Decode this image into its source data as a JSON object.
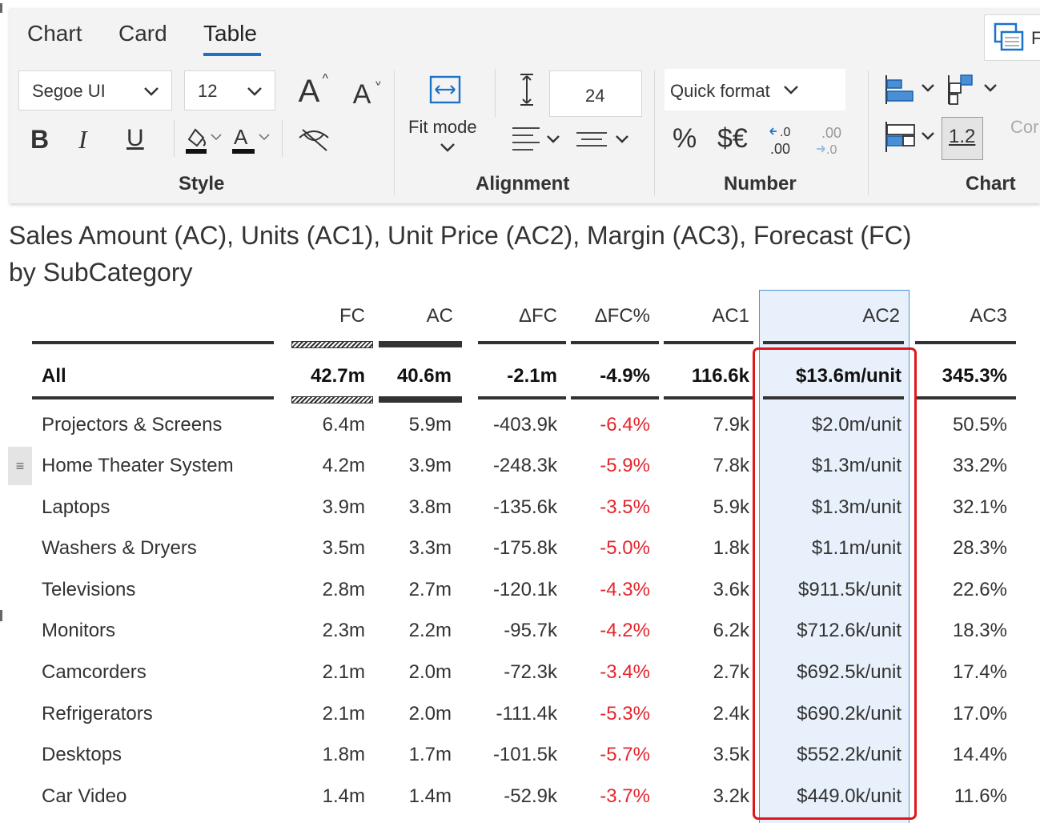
{
  "ribbon": {
    "tabs": [
      {
        "label": "Chart"
      },
      {
        "label": "Card"
      },
      {
        "label": "Table"
      }
    ],
    "active_tab": "Table",
    "style": {
      "font_family": "Segoe UI",
      "font_size": "12",
      "bold": "B",
      "italic": "I",
      "underline": "U",
      "group_label": "Style"
    },
    "alignment": {
      "fit_mode_label": "Fit mode",
      "row_height": "24",
      "group_label": "Alignment"
    },
    "number": {
      "quick_format_label": "Quick format",
      "percent_label": "%",
      "currency_label": "$€",
      "group_label": "Number"
    },
    "chart": {
      "decimal_label": "1.2",
      "partial_label": "Cor",
      "group_label": "Chart"
    },
    "panel_partial_label": "F"
  },
  "visual": {
    "title_line1": "Sales Amount (AC), Units (AC1), Unit Price (AC2), Margin (AC3), Forecast (FC)",
    "title_line2": "by SubCategory"
  },
  "table": {
    "columns": [
      "FC",
      "AC",
      "ΔFC",
      "ΔFC%",
      "AC1",
      "AC2",
      "AC3"
    ],
    "selected_column": "AC2",
    "total": {
      "name": "All",
      "values": [
        "42.7m",
        "40.6m",
        "-2.1m",
        "-4.9%",
        "116.6k",
        "$13.6m/unit",
        "345.3%"
      ]
    },
    "rows": [
      {
        "name": "Projectors & Screens",
        "values": [
          "6.4m",
          "5.9m",
          "-403.9k",
          "-6.4%",
          "7.9k",
          "$2.0m/unit",
          "50.5%"
        ]
      },
      {
        "name": "Home Theater System",
        "values": [
          "4.2m",
          "3.9m",
          "-248.3k",
          "-5.9%",
          "7.8k",
          "$1.3m/unit",
          "33.2%"
        ]
      },
      {
        "name": "Laptops",
        "values": [
          "3.9m",
          "3.8m",
          "-135.6k",
          "-3.5%",
          "5.9k",
          "$1.3m/unit",
          "32.1%"
        ]
      },
      {
        "name": "Washers & Dryers",
        "values": [
          "3.5m",
          "3.3m",
          "-175.8k",
          "-5.0%",
          "1.8k",
          "$1.1m/unit",
          "28.3%"
        ]
      },
      {
        "name": "Televisions",
        "values": [
          "2.8m",
          "2.7m",
          "-120.1k",
          "-4.3%",
          "3.6k",
          "$911.5k/unit",
          "22.6%"
        ]
      },
      {
        "name": "Monitors",
        "values": [
          "2.3m",
          "2.2m",
          "-95.7k",
          "-4.2%",
          "6.2k",
          "$712.6k/unit",
          "18.3%"
        ]
      },
      {
        "name": "Camcorders",
        "values": [
          "2.1m",
          "2.0m",
          "-72.3k",
          "-3.4%",
          "2.7k",
          "$692.5k/unit",
          "17.4%"
        ]
      },
      {
        "name": "Refrigerators",
        "values": [
          "2.1m",
          "2.0m",
          "-111.4k",
          "-5.3%",
          "2.4k",
          "$690.2k/unit",
          "17.0%"
        ]
      },
      {
        "name": "Desktops",
        "values": [
          "1.8m",
          "1.7m",
          "-101.5k",
          "-5.7%",
          "3.5k",
          "$552.2k/unit",
          "14.4%"
        ]
      },
      {
        "name": "Car Video",
        "values": [
          "1.4m",
          "1.4m",
          "-52.9k",
          "-3.7%",
          "3.2k",
          "$449.0k/unit",
          "11.6%"
        ]
      }
    ]
  },
  "colors": {
    "accent": "#1a73c9",
    "negative": "#e3262f",
    "highlight_box": "#e0161e",
    "selected_column_bg": "#e8f1fb"
  }
}
